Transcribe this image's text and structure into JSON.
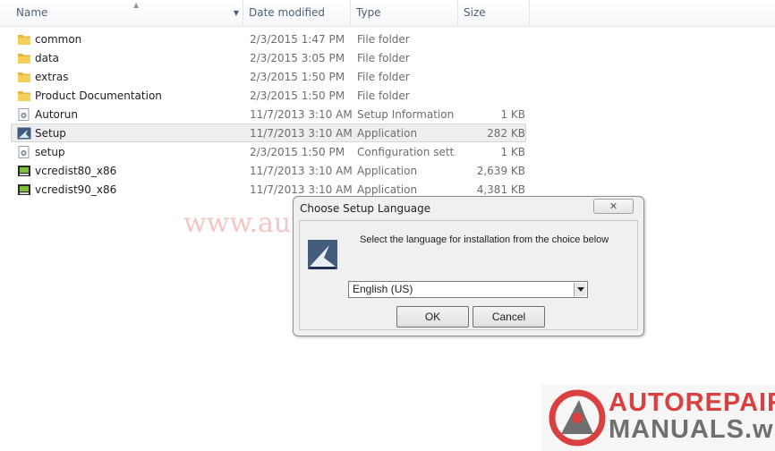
{
  "columns": {
    "name": "Name",
    "date": "Date modified",
    "type": "Type",
    "size": "Size"
  },
  "files": [
    {
      "name": "common",
      "date": "2/3/2015 1:47 PM",
      "type": "File folder",
      "size": "",
      "icon": "folder-icon"
    },
    {
      "name": "data",
      "date": "2/3/2015 3:05 PM",
      "type": "File folder",
      "size": "",
      "icon": "folder-icon"
    },
    {
      "name": "extras",
      "date": "2/3/2015 1:50 PM",
      "type": "File folder",
      "size": "",
      "icon": "folder-icon"
    },
    {
      "name": "Product Documentation",
      "date": "2/3/2015 1:50 PM",
      "type": "File folder",
      "size": "",
      "icon": "folder-icon"
    },
    {
      "name": "Autorun",
      "date": "11/7/2013 3:10 AM",
      "type": "Setup Information",
      "size": "1 KB",
      "icon": "settings-file-icon"
    },
    {
      "name": "Setup",
      "date": "11/7/2013 3:10 AM",
      "type": "Application",
      "size": "282 KB",
      "icon": "setup-app-icon"
    },
    {
      "name": "setup",
      "date": "2/3/2015 1:50 PM",
      "type": "Configuration sett...",
      "size": "1 KB",
      "icon": "settings-file-icon"
    },
    {
      "name": "vcredist80_x86",
      "date": "11/7/2013 3:10 AM",
      "type": "Application",
      "size": "2,639 KB",
      "icon": "installer-icon"
    },
    {
      "name": "vcredist90_x86",
      "date": "11/7/2013 3:10 AM",
      "type": "Application",
      "size": "4,381 KB",
      "icon": "installer-icon"
    }
  ],
  "selected_row": 5,
  "dialog": {
    "title": "Choose Setup Language",
    "close_glyph": "✕",
    "message": "Select the language for installation from the choice below",
    "language_selected": "English (US)",
    "ok_label": "OK",
    "cancel_label": "Cancel"
  },
  "watermark": {
    "url_text": "www.autorepairmanuals.ws",
    "logo_line1": "AUTOREPAIR",
    "logo_line2": "MANUALS.ws"
  },
  "colors": {
    "accent_red": "#d9403f",
    "header_text": "#4c607a"
  }
}
